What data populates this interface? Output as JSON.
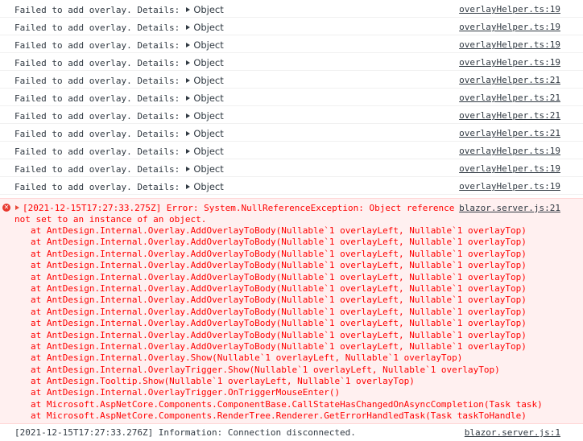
{
  "warn_rows": [
    {
      "message": "Failed to add overlay. Details:",
      "object": "Object",
      "source": "overlayHelper.ts:19"
    },
    {
      "message": "Failed to add overlay. Details:",
      "object": "Object",
      "source": "overlayHelper.ts:19"
    },
    {
      "message": "Failed to add overlay. Details:",
      "object": "Object",
      "source": "overlayHelper.ts:19"
    },
    {
      "message": "Failed to add overlay. Details:",
      "object": "Object",
      "source": "overlayHelper.ts:19"
    },
    {
      "message": "Failed to add overlay. Details:",
      "object": "Object",
      "source": "overlayHelper.ts:21"
    },
    {
      "message": "Failed to add overlay. Details:",
      "object": "Object",
      "source": "overlayHelper.ts:21"
    },
    {
      "message": "Failed to add overlay. Details:",
      "object": "Object",
      "source": "overlayHelper.ts:21"
    },
    {
      "message": "Failed to add overlay. Details:",
      "object": "Object",
      "source": "overlayHelper.ts:21"
    },
    {
      "message": "Failed to add overlay. Details:",
      "object": "Object",
      "source": "overlayHelper.ts:19"
    },
    {
      "message": "Failed to add overlay. Details:",
      "object": "Object",
      "source": "overlayHelper.ts:19"
    },
    {
      "message": "Failed to add overlay. Details:",
      "object": "Object",
      "source": "overlayHelper.ts:19"
    }
  ],
  "error": {
    "icon": "error-x-icon",
    "header": "[2021-12-15T17:27:33.275Z] Error: System.NullReferenceException: Object reference",
    "continuation": "not set to an instance of an object.",
    "source": "blazor.server.js:21",
    "stack": [
      "at AntDesign.Internal.Overlay.AddOverlayToBody(Nullable`1 overlayLeft, Nullable`1 overlayTop)",
      "at AntDesign.Internal.Overlay.AddOverlayToBody(Nullable`1 overlayLeft, Nullable`1 overlayTop)",
      "at AntDesign.Internal.Overlay.AddOverlayToBody(Nullable`1 overlayLeft, Nullable`1 overlayTop)",
      "at AntDesign.Internal.Overlay.AddOverlayToBody(Nullable`1 overlayLeft, Nullable`1 overlayTop)",
      "at AntDesign.Internal.Overlay.AddOverlayToBody(Nullable`1 overlayLeft, Nullable`1 overlayTop)",
      "at AntDesign.Internal.Overlay.AddOverlayToBody(Nullable`1 overlayLeft, Nullable`1 overlayTop)",
      "at AntDesign.Internal.Overlay.AddOverlayToBody(Nullable`1 overlayLeft, Nullable`1 overlayTop)",
      "at AntDesign.Internal.Overlay.AddOverlayToBody(Nullable`1 overlayLeft, Nullable`1 overlayTop)",
      "at AntDesign.Internal.Overlay.AddOverlayToBody(Nullable`1 overlayLeft, Nullable`1 overlayTop)",
      "at AntDesign.Internal.Overlay.AddOverlayToBody(Nullable`1 overlayLeft, Nullable`1 overlayTop)",
      "at AntDesign.Internal.Overlay.AddOverlayToBody(Nullable`1 overlayLeft, Nullable`1 overlayTop)",
      "at AntDesign.Internal.Overlay.Show(Nullable`1 overlayLeft, Nullable`1 overlayTop)",
      "at AntDesign.Internal.OverlayTrigger.Show(Nullable`1 overlayLeft, Nullable`1 overlayTop)",
      "at AntDesign.Tooltip.Show(Nullable`1 overlayLeft, Nullable`1 overlayTop)",
      "at AntDesign.Internal.OverlayTrigger.OnTriggerMouseEnter()",
      "at Microsoft.AspNetCore.Components.ComponentBase.CallStateHasChangedOnAsyncCompletion(Task task)",
      "at Microsoft.AspNetCore.Components.RenderTree.Renderer.GetErrorHandledTask(Task taskToHandle)"
    ]
  },
  "info": {
    "message": "[2021-12-15T17:27:33.276Z] Information: Connection disconnected.",
    "source": "blazor.server.js:1"
  }
}
